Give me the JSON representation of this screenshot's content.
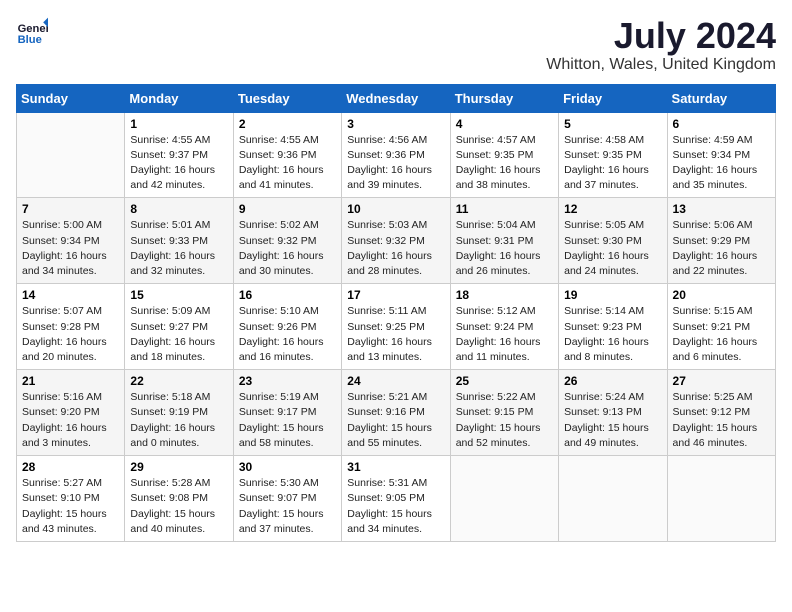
{
  "logo": {
    "line1": "General",
    "line2": "Blue"
  },
  "calendar": {
    "title": "July 2024",
    "subtitle": "Whitton, Wales, United Kingdom"
  },
  "weekdays": [
    "Sunday",
    "Monday",
    "Tuesday",
    "Wednesday",
    "Thursday",
    "Friday",
    "Saturday"
  ],
  "weeks": [
    [
      {
        "day": "",
        "info": ""
      },
      {
        "day": "1",
        "info": "Sunrise: 4:55 AM\nSunset: 9:37 PM\nDaylight: 16 hours\nand 42 minutes."
      },
      {
        "day": "2",
        "info": "Sunrise: 4:55 AM\nSunset: 9:36 PM\nDaylight: 16 hours\nand 41 minutes."
      },
      {
        "day": "3",
        "info": "Sunrise: 4:56 AM\nSunset: 9:36 PM\nDaylight: 16 hours\nand 39 minutes."
      },
      {
        "day": "4",
        "info": "Sunrise: 4:57 AM\nSunset: 9:35 PM\nDaylight: 16 hours\nand 38 minutes."
      },
      {
        "day": "5",
        "info": "Sunrise: 4:58 AM\nSunset: 9:35 PM\nDaylight: 16 hours\nand 37 minutes."
      },
      {
        "day": "6",
        "info": "Sunrise: 4:59 AM\nSunset: 9:34 PM\nDaylight: 16 hours\nand 35 minutes."
      }
    ],
    [
      {
        "day": "7",
        "info": "Sunrise: 5:00 AM\nSunset: 9:34 PM\nDaylight: 16 hours\nand 34 minutes."
      },
      {
        "day": "8",
        "info": "Sunrise: 5:01 AM\nSunset: 9:33 PM\nDaylight: 16 hours\nand 32 minutes."
      },
      {
        "day": "9",
        "info": "Sunrise: 5:02 AM\nSunset: 9:32 PM\nDaylight: 16 hours\nand 30 minutes."
      },
      {
        "day": "10",
        "info": "Sunrise: 5:03 AM\nSunset: 9:32 PM\nDaylight: 16 hours\nand 28 minutes."
      },
      {
        "day": "11",
        "info": "Sunrise: 5:04 AM\nSunset: 9:31 PM\nDaylight: 16 hours\nand 26 minutes."
      },
      {
        "day": "12",
        "info": "Sunrise: 5:05 AM\nSunset: 9:30 PM\nDaylight: 16 hours\nand 24 minutes."
      },
      {
        "day": "13",
        "info": "Sunrise: 5:06 AM\nSunset: 9:29 PM\nDaylight: 16 hours\nand 22 minutes."
      }
    ],
    [
      {
        "day": "14",
        "info": "Sunrise: 5:07 AM\nSunset: 9:28 PM\nDaylight: 16 hours\nand 20 minutes."
      },
      {
        "day": "15",
        "info": "Sunrise: 5:09 AM\nSunset: 9:27 PM\nDaylight: 16 hours\nand 18 minutes."
      },
      {
        "day": "16",
        "info": "Sunrise: 5:10 AM\nSunset: 9:26 PM\nDaylight: 16 hours\nand 16 minutes."
      },
      {
        "day": "17",
        "info": "Sunrise: 5:11 AM\nSunset: 9:25 PM\nDaylight: 16 hours\nand 13 minutes."
      },
      {
        "day": "18",
        "info": "Sunrise: 5:12 AM\nSunset: 9:24 PM\nDaylight: 16 hours\nand 11 minutes."
      },
      {
        "day": "19",
        "info": "Sunrise: 5:14 AM\nSunset: 9:23 PM\nDaylight: 16 hours\nand 8 minutes."
      },
      {
        "day": "20",
        "info": "Sunrise: 5:15 AM\nSunset: 9:21 PM\nDaylight: 16 hours\nand 6 minutes."
      }
    ],
    [
      {
        "day": "21",
        "info": "Sunrise: 5:16 AM\nSunset: 9:20 PM\nDaylight: 16 hours\nand 3 minutes."
      },
      {
        "day": "22",
        "info": "Sunrise: 5:18 AM\nSunset: 9:19 PM\nDaylight: 16 hours\nand 0 minutes."
      },
      {
        "day": "23",
        "info": "Sunrise: 5:19 AM\nSunset: 9:17 PM\nDaylight: 15 hours\nand 58 minutes."
      },
      {
        "day": "24",
        "info": "Sunrise: 5:21 AM\nSunset: 9:16 PM\nDaylight: 15 hours\nand 55 minutes."
      },
      {
        "day": "25",
        "info": "Sunrise: 5:22 AM\nSunset: 9:15 PM\nDaylight: 15 hours\nand 52 minutes."
      },
      {
        "day": "26",
        "info": "Sunrise: 5:24 AM\nSunset: 9:13 PM\nDaylight: 15 hours\nand 49 minutes."
      },
      {
        "day": "27",
        "info": "Sunrise: 5:25 AM\nSunset: 9:12 PM\nDaylight: 15 hours\nand 46 minutes."
      }
    ],
    [
      {
        "day": "28",
        "info": "Sunrise: 5:27 AM\nSunset: 9:10 PM\nDaylight: 15 hours\nand 43 minutes."
      },
      {
        "day": "29",
        "info": "Sunrise: 5:28 AM\nSunset: 9:08 PM\nDaylight: 15 hours\nand 40 minutes."
      },
      {
        "day": "30",
        "info": "Sunrise: 5:30 AM\nSunset: 9:07 PM\nDaylight: 15 hours\nand 37 minutes."
      },
      {
        "day": "31",
        "info": "Sunrise: 5:31 AM\nSunset: 9:05 PM\nDaylight: 15 hours\nand 34 minutes."
      },
      {
        "day": "",
        "info": ""
      },
      {
        "day": "",
        "info": ""
      },
      {
        "day": "",
        "info": ""
      }
    ]
  ]
}
